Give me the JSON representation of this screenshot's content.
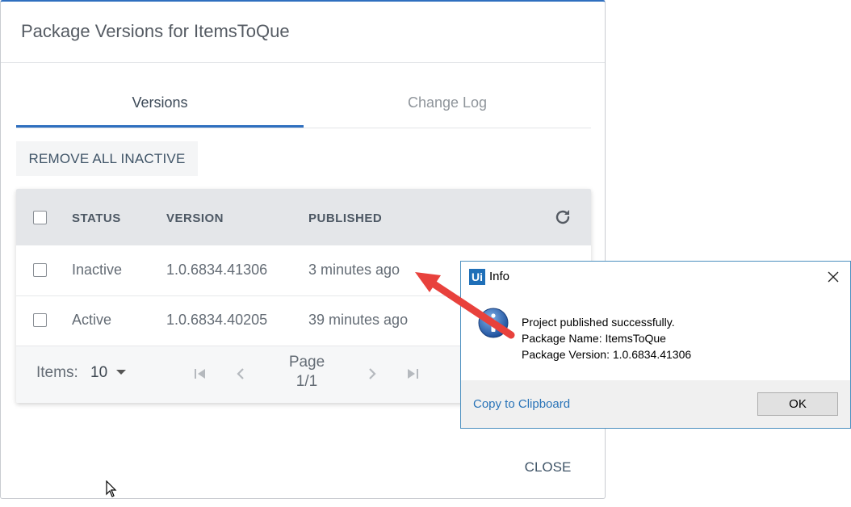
{
  "modal": {
    "title": "Package Versions for ItemsToQue",
    "tabs": [
      {
        "label": "Versions",
        "active": true
      },
      {
        "label": "Change Log",
        "active": false
      }
    ],
    "remove_all_label": "REMOVE ALL INACTIVE",
    "table": {
      "columns": [
        "STATUS",
        "VERSION",
        "PUBLISHED"
      ],
      "rows": [
        {
          "status": "Inactive",
          "version": "1.0.6834.41306",
          "published": "3 minutes ago"
        },
        {
          "status": "Active",
          "version": "1.0.6834.40205",
          "published": "39 minutes ago"
        }
      ]
    },
    "pager": {
      "items_label": "Items:",
      "items_value": "10",
      "page_label": "Page",
      "page_value": "1/1"
    },
    "close_label": "CLOSE"
  },
  "dialog": {
    "logo": "Ui",
    "title": "Info",
    "lines": [
      "Project published successfully.",
      "Package Name: ItemsToQue",
      "Package Version: 1.0.6834.41306"
    ],
    "copy_label": "Copy to Clipboard",
    "ok_label": "OK"
  },
  "colors": {
    "accent": "#2f6fbf",
    "arrow": "#e8413c",
    "link": "#2a74b8"
  },
  "icons": [
    "refresh-icon",
    "first-page-icon",
    "prev-page-icon",
    "next-page-icon",
    "last-page-icon",
    "dropdown-caret-icon",
    "info-icon",
    "close-icon",
    "mouse-cursor-icon"
  ]
}
